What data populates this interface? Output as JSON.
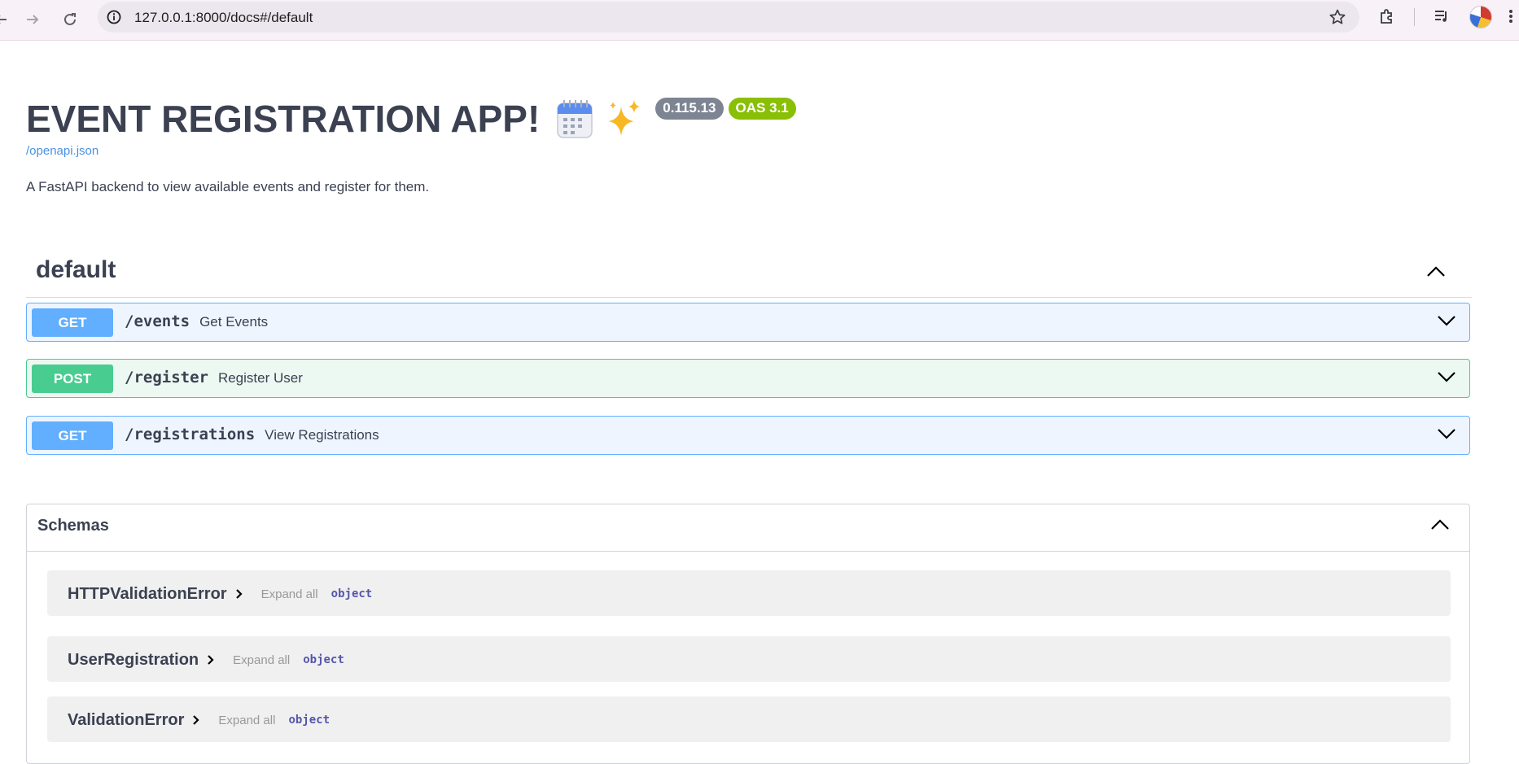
{
  "browser": {
    "url": "127.0.0.1:8000/docs#/default",
    "icons": [
      "back-arrow-icon",
      "forward-arrow-icon",
      "reload-icon",
      "site-info-icon",
      "bookmark-star-icon",
      "extensions-icon",
      "media-controls-icon",
      "profile-avatar",
      "chrome-menu-icon"
    ]
  },
  "header": {
    "title": "EVENT REGISTRATION APP!",
    "emojis": [
      "calendar-emoji",
      "sparkles-emoji"
    ],
    "version_badge": "0.115.13",
    "oas_badge": "OAS 3.1",
    "spec_link": "/openapi.json",
    "description": "A FastAPI backend to view available events and register for them."
  },
  "tag": {
    "name": "default",
    "operations": [
      {
        "method": "GET",
        "path": "/events",
        "summary": "Get Events"
      },
      {
        "method": "POST",
        "path": "/register",
        "summary": "Register User"
      },
      {
        "method": "GET",
        "path": "/registrations",
        "summary": "View Registrations"
      }
    ]
  },
  "schemas": {
    "title": "Schemas",
    "models": [
      {
        "name": "HTTPValidationError",
        "expand": "Expand all",
        "type": "object"
      },
      {
        "name": "UserRegistration",
        "expand": "Expand all",
        "type": "object"
      },
      {
        "name": "ValidationError",
        "expand": "Expand all",
        "type": "object"
      }
    ]
  },
  "colors": {
    "get": "#61affe",
    "post": "#49cc90",
    "version_badge": "#7d8492",
    "oas_badge": "#89bf04",
    "link": "#4990e2",
    "text": "#3b4151"
  }
}
